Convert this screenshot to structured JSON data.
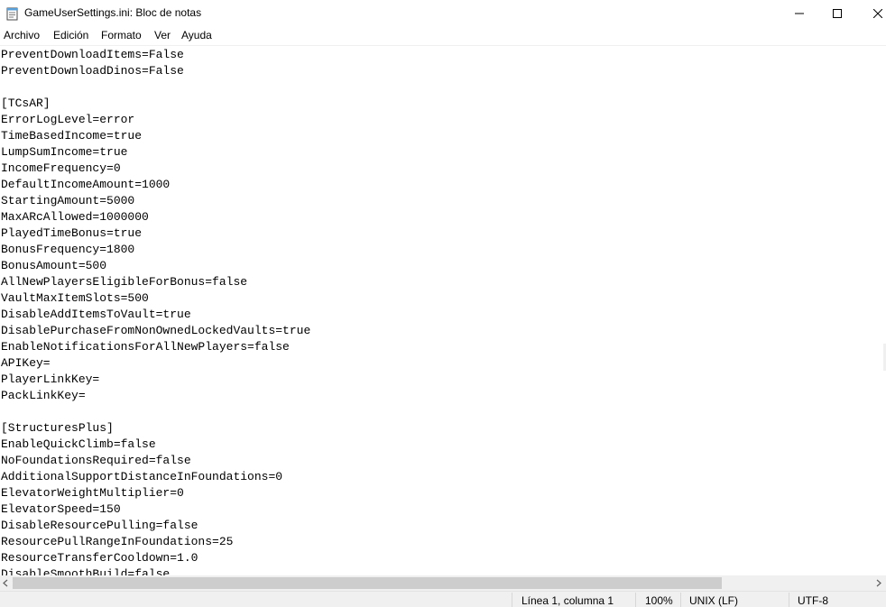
{
  "window": {
    "title": "GameUserSettings.ini: Bloc de notas",
    "icon": "notepad-icon"
  },
  "menu": [
    "Archivo",
    "Edición",
    "Formato",
    "Ver",
    "Ayuda"
  ],
  "editor": {
    "lines": [
      "PreventDownloadItems=False",
      "PreventDownloadDinos=False",
      "",
      "[TCsAR]",
      "ErrorLogLevel=error",
      "TimeBasedIncome=true",
      "LumpSumIncome=true",
      "IncomeFrequency=0",
      "DefaultIncomeAmount=1000",
      "StartingAmount=5000",
      "MaxARcAllowed=1000000",
      "PlayedTimeBonus=true",
      "BonusFrequency=1800",
      "BonusAmount=500",
      "AllNewPlayersEligibleForBonus=false",
      "VaultMaxItemSlots=500",
      "DisableAddItemsToVault=true",
      "DisablePurchaseFromNonOwnedLockedVaults=true",
      "EnableNotificationsForAllNewPlayers=false",
      "APIKey=",
      "PlayerLinkKey=",
      "PackLinkKey=",
      "",
      "[StructuresPlus]",
      "EnableQuickClimb=false",
      "NoFoundationsRequired=false",
      "AdditionalSupportDistanceInFoundations=0",
      "ElevatorWeightMultiplier=0",
      "ElevatorSpeed=150",
      "DisableResourcePulling=false",
      "ResourcePullRangeInFoundations=25",
      "ResourceTransferCooldown=1.0",
      "DisableSmoothBuild=false"
    ]
  },
  "statusbar": {
    "position": "Línea 1, columna 1",
    "zoom": "100%",
    "line_ending": "UNIX (LF)",
    "encoding": "UTF-8"
  }
}
